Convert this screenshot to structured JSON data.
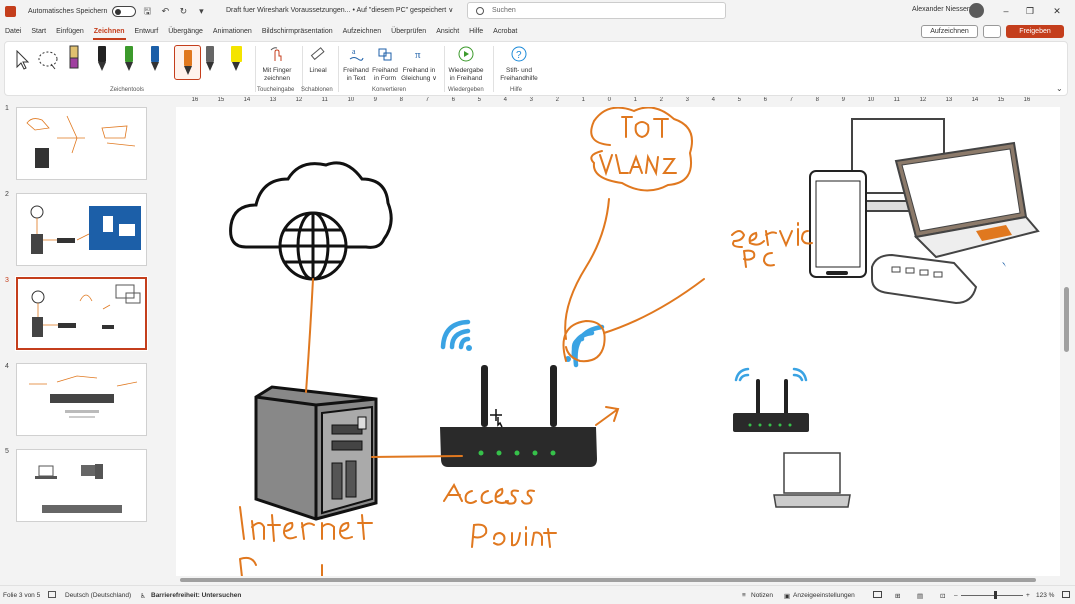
{
  "titlebar": {
    "autosave_label": "Automatisches Speichern",
    "doc_title": "Draft fuer Wireshark Voraussetzungen... • Auf \"diesem PC\" gespeichert ∨",
    "search_placeholder": "Suchen",
    "user_name": "Alexander Niessen",
    "minimize": "–",
    "restore": "❐",
    "close": "✕"
  },
  "tabs": [
    "Datei",
    "Start",
    "Einfügen",
    "Zeichnen",
    "Entwurf",
    "Übergänge",
    "Animationen",
    "Bildschirmpräsentation",
    "Aufzeichnen",
    "Überprüfen",
    "Ansicht",
    "Hilfe",
    "Acrobat"
  ],
  "active_tab": "Zeichnen",
  "header_buttons": {
    "record": "Aufzeichnen",
    "share": "Freigeben"
  },
  "ribbon": {
    "groups": {
      "drawing_tools": "Zeichentools",
      "touch_input": "Toucheingabe",
      "stencils": "Schablonen",
      "convert": "Konvertieren",
      "replay": "Wiedergeben",
      "help": "Hilfe"
    },
    "items": {
      "finger_draw": "Mit Finger zeichnen",
      "ruler": "Lineal",
      "ink_to_text": "Freihand in Text",
      "ink_to_shape": "Freihand in Form",
      "ink_to_math": "Freihand in Gleichung ∨",
      "ink_replay": "Wiedergabe in Freihand",
      "pen_help": "Stift- und Freihandhilfe"
    }
  },
  "slides": [
    {
      "number": "1"
    },
    {
      "number": "2"
    },
    {
      "number": "3"
    },
    {
      "number": "4"
    },
    {
      "number": "5"
    }
  ],
  "active_slide": "3",
  "ruler_numbers": [
    "16",
    "15",
    "14",
    "13",
    "12",
    "11",
    "10",
    "9",
    "8",
    "7",
    "6",
    "5",
    "4",
    "3",
    "2",
    "1",
    "0",
    "1",
    "2",
    "3",
    "4",
    "5",
    "6",
    "7",
    "8",
    "9",
    "10",
    "11",
    "12",
    "13",
    "14",
    "15",
    "16"
  ],
  "status": {
    "slide_of": "Folie 3 von 5",
    "language": "Deutsch (Deutschland)",
    "accessibility": "Barrierefreiheit: Untersuchen",
    "notes": "Notizen",
    "display_settings": "Anzeigeeinstellungen",
    "zoom": "123 %"
  },
  "colors": {
    "accent": "#c43e1c",
    "ink": "#e0781f",
    "wifi": "#3aa3e3"
  }
}
